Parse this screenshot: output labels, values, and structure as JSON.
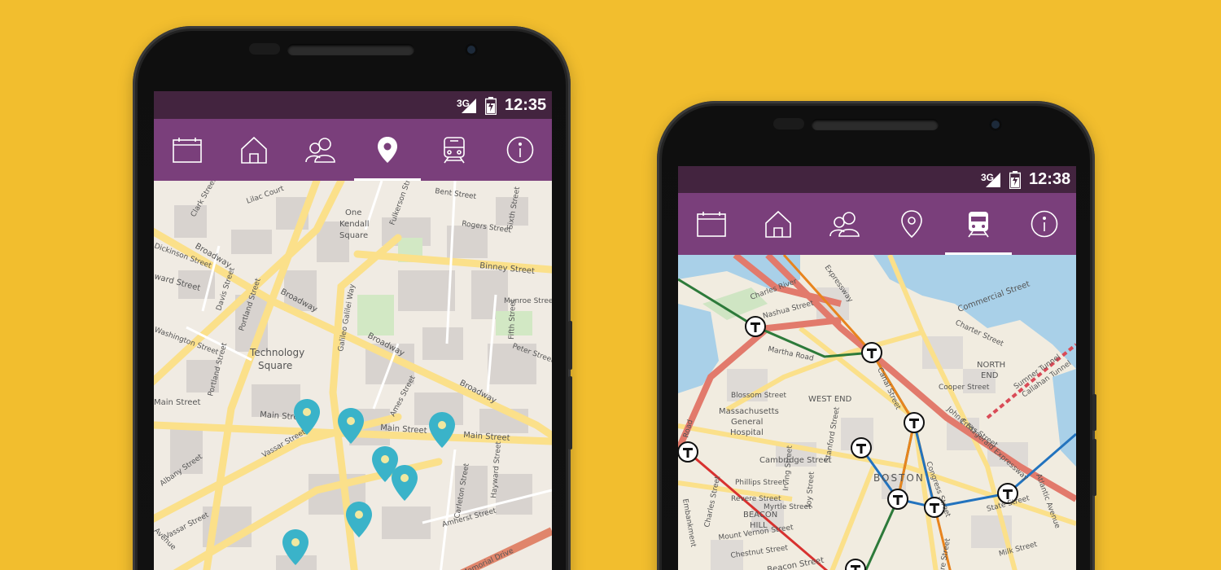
{
  "colors": {
    "background": "#F2BE2E",
    "statusbar": "#43243F",
    "navbar": "#7A3F7B",
    "pin": "#3AB3C9"
  },
  "phone_left": {
    "status": {
      "network": "3G",
      "time": "12:35"
    },
    "nav": [
      {
        "icon": "calendar-icon",
        "active": false
      },
      {
        "icon": "home-icon",
        "active": false
      },
      {
        "icon": "people-icon",
        "active": false
      },
      {
        "icon": "map-pin-icon",
        "active": true
      },
      {
        "icon": "train-icon",
        "active": false
      },
      {
        "icon": "info-icon",
        "active": false
      }
    ],
    "map_labels": {
      "lilac": "Lilac Court",
      "bent": "Bent Street",
      "one": "One",
      "kendall": "Kendall",
      "square": "Square",
      "fulkerson": "Fulkerson Street",
      "rogers": "Rogers Street",
      "sixth": "Sixth Street",
      "dickinson": "Dickinson Street",
      "broadway1": "Broadway",
      "binney": "Binney Street",
      "ward": "ward Street",
      "portland": "Portland Street",
      "davis": "Davis Street",
      "broadway2": "Broadway",
      "galileo": "Galileo Galilei Way",
      "munroe": "Munroe Street",
      "fifth": "Fifth Street",
      "washington": "Washington Street",
      "technology": "Technology",
      "tsquare": "Square",
      "broadway3": "Broadway",
      "peter": "Peter Street",
      "portland2": "Portland Street",
      "ames": "Ames Street",
      "broadway4": "Broadway",
      "main1": "Main Street",
      "main2": "Main Street",
      "main3": "Main Street",
      "main4": "Main Street",
      "albany": "Albany Street",
      "vassar1": "Vassar Street",
      "vassar2": "Vassar Street",
      "carleton": "Carleton Street",
      "hayward": "Hayward Street",
      "amherst": "Amherst Street",
      "memorial": "Memorial Drive",
      "avenue": "Avenue",
      "clark": "Clark Street"
    }
  },
  "phone_right": {
    "status": {
      "network": "3G",
      "time": "12:38"
    },
    "nav": [
      {
        "icon": "calendar-icon",
        "active": false
      },
      {
        "icon": "home-icon",
        "active": false
      },
      {
        "icon": "people-icon",
        "active": false
      },
      {
        "icon": "map-pin-icon",
        "active": false
      },
      {
        "icon": "train-icon",
        "active": true
      },
      {
        "icon": "info-icon",
        "active": false
      }
    ],
    "map_labels": {
      "charles": "Charles River",
      "nashua": "Nashua Street",
      "martha": "Martha Road",
      "expressway": "Expressway",
      "commercial": "Commercial Street",
      "charter": "Charter Street",
      "north": "NORTH",
      "end": "END",
      "canal": "Canal Street",
      "cooper": "Cooper Street",
      "blossom": "Blossom Street",
      "westend": "WEST END",
      "mgh1": "Massachusetts",
      "mgh2": "General",
      "mgh3": "Hospital",
      "stanford": "Stanford Street",
      "cross": "Cross Street",
      "jfk": "John F Fitzgerald Expressway",
      "sumner": "Sumner Tunnel",
      "callahan": "Callahan Tunnel",
      "cambridge": "Cambridge Street",
      "boston": "BOSTON",
      "phillips": "Phillips Street",
      "revere": "Revere Street",
      "myrtle": "Myrtle Street",
      "beacon": "BEACON",
      "hill": "HILL",
      "mtvernon": "Mount Vernon Street",
      "chestnut": "Chestnut Street",
      "beaconst": "Beacon Street",
      "charlesst": "Charles Street",
      "congress": "Congress Street",
      "state": "State Street",
      "atlantic": "Atlantic Avenue",
      "milk": "Milk Street",
      "joy": "Joy Street",
      "irving": "Irving Street",
      "hampshire": "shire Street",
      "road": "Road",
      "embankment": "Embankment"
    }
  }
}
